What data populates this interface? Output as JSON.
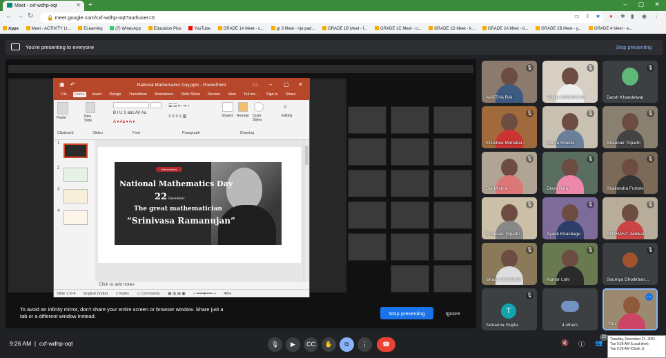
{
  "browser": {
    "tab_title": "Meet - cxf-wdhp-oqt",
    "url": "meet.google.com/cxf-wdhp-oqt?authuser=0",
    "bookmarks": [
      "Apps",
      "Meet - ACTIVITY LI...",
      "ELearning",
      "(7) WhatsApp",
      "Education Plus",
      "YouTube",
      "GRADE 1A Meet - c...",
      "gr 3 Meet - njo-pad...",
      "GRADE 1B Meet - f...",
      "GRADE 1C Meet - o...",
      "GRADE 1D Meet - k...",
      "GRADE 2A Meet - b...",
      "GRADE 2B Meet - y...",
      "GRADE 4 Meet - e..."
    ]
  },
  "banner": {
    "text": "You're presenting to everyone",
    "stop_link": "Stop presenting"
  },
  "powerpoint": {
    "title": "National Mathematics Day.pptx - PowerPoint",
    "tabs": [
      "File",
      "Home",
      "Insert",
      "Design",
      "Transitions",
      "Animations",
      "Slide Show",
      "Review",
      "View",
      "Tell me...",
      "Sign in",
      "Share"
    ],
    "groups": [
      "Clipboard",
      "Slides",
      "Font",
      "Paragraph",
      "Drawing",
      "Editing"
    ],
    "buttons": [
      "Paste",
      "New Slide",
      "Shapes",
      "Arrange",
      "Quick Styles",
      "Editing"
    ],
    "slide_numbers": [
      "1",
      "2",
      "3",
      "4"
    ],
    "slide": {
      "tag": "Mathematics",
      "line1": "National Mathematics Day",
      "date_num": "22",
      "date_month": "December",
      "line3": "The great mathematician",
      "line4": "“Srinivasa Ramanujan”"
    },
    "notes_placeholder": "Click to add notes",
    "status": {
      "slide_of": "Slide 1 of 4",
      "language": "English (India)",
      "notes": "Notes",
      "comments": "Comments",
      "zoom": "46%"
    }
  },
  "share_warning": "To avoid an infinity mirror, don't share your entire screen or browser window. Share just a tab or a different window instead.",
  "share_buttons": {
    "stop": "Stop presenting",
    "ignore": "Ignore"
  },
  "participants": [
    {
      "name": "AASTHA RAI",
      "muted": true
    },
    {
      "name": "Vaidik ARMARKAR",
      "muted": true
    },
    {
      "name": "Darsh Khandelwal",
      "muted": true
    },
    {
      "name": "Khushee Mahakal...",
      "muted": true
    },
    {
      "name": "Aditya Shukla",
      "muted": true
    },
    {
      "name": "Shaunak Tripathi",
      "muted": true
    },
    {
      "name": "Dia Mishra",
      "muted": true
    },
    {
      "name": "Divya Birla",
      "muted": true
    },
    {
      "name": "Shailendra Fulzele",
      "muted": true
    },
    {
      "name": "Shaunak Tripathi",
      "muted": true
    },
    {
      "name": "Ayank Khasbage",
      "muted": true
    },
    {
      "name": "SUSHANT Jwnikar",
      "muted": true
    },
    {
      "name": "Ishaan wankhede",
      "muted": true
    },
    {
      "name": "Kumar Lohi",
      "muted": true
    },
    {
      "name": "Soumya Ghodkhan...",
      "muted": true
    },
    {
      "name": "Tamanna Gupta",
      "muted": true,
      "initial": "T"
    },
    {
      "name": "4 others",
      "muted": false
    },
    {
      "name": "You",
      "muted": false
    }
  ],
  "bottom": {
    "time": "9:26 AM",
    "meeting_code": "cxf-wdhp-oqt",
    "people_count": "22"
  },
  "tooltip": {
    "date": "Tuesday, December 21, 2021",
    "local": "Tue 9:26 AM  (Local time)",
    "clock1": "Tue 9:26 AM  (Clock 1)"
  },
  "colors": {
    "accent": "#1a73e8",
    "ppt": "#b7472a",
    "end_call": "#ea4335",
    "tabbar": "#3c8a3c"
  }
}
